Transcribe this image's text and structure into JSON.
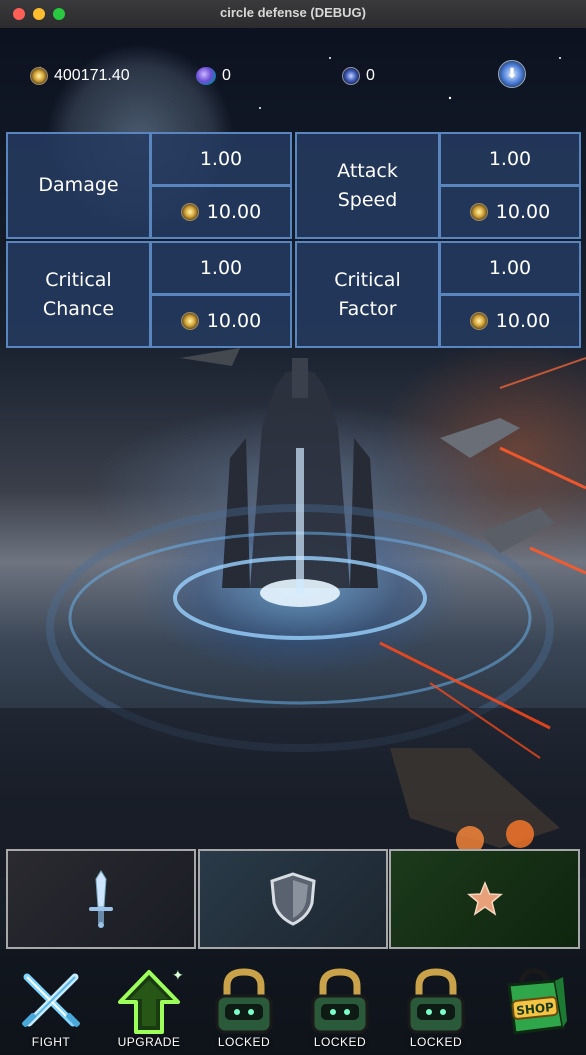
{
  "window": {
    "title": "circle defense (DEBUG)"
  },
  "resources": {
    "coins": "400171.40",
    "gems": "0",
    "medals": "0"
  },
  "upgrades": [
    {
      "label_line1": "Damage",
      "label_line2": "",
      "value": "1.00",
      "cost": "10.00"
    },
    {
      "label_line1": "Attack",
      "label_line2": "Speed",
      "value": "1.00",
      "cost": "10.00"
    },
    {
      "label_line1": "Critical",
      "label_line2": "Chance",
      "value": "1.00",
      "cost": "10.00"
    },
    {
      "label_line1": "Critical",
      "label_line2": "Factor",
      "value": "1.00",
      "cost": "10.00"
    }
  ],
  "slots": [
    {
      "icon": "sword-icon"
    },
    {
      "icon": "shield-icon"
    },
    {
      "icon": "star-icon"
    }
  ],
  "nav": [
    {
      "label": "FIGHT",
      "icon": "crossed-swords-icon"
    },
    {
      "label": "UPGRADE",
      "icon": "upgrade-arrow-icon"
    },
    {
      "label": "LOCKED",
      "icon": "lock-icon"
    },
    {
      "label": "LOCKED",
      "icon": "lock-icon"
    },
    {
      "label": "LOCKED",
      "icon": "lock-icon"
    },
    {
      "label": "SHOP",
      "icon": "shop-bag-icon"
    }
  ]
}
